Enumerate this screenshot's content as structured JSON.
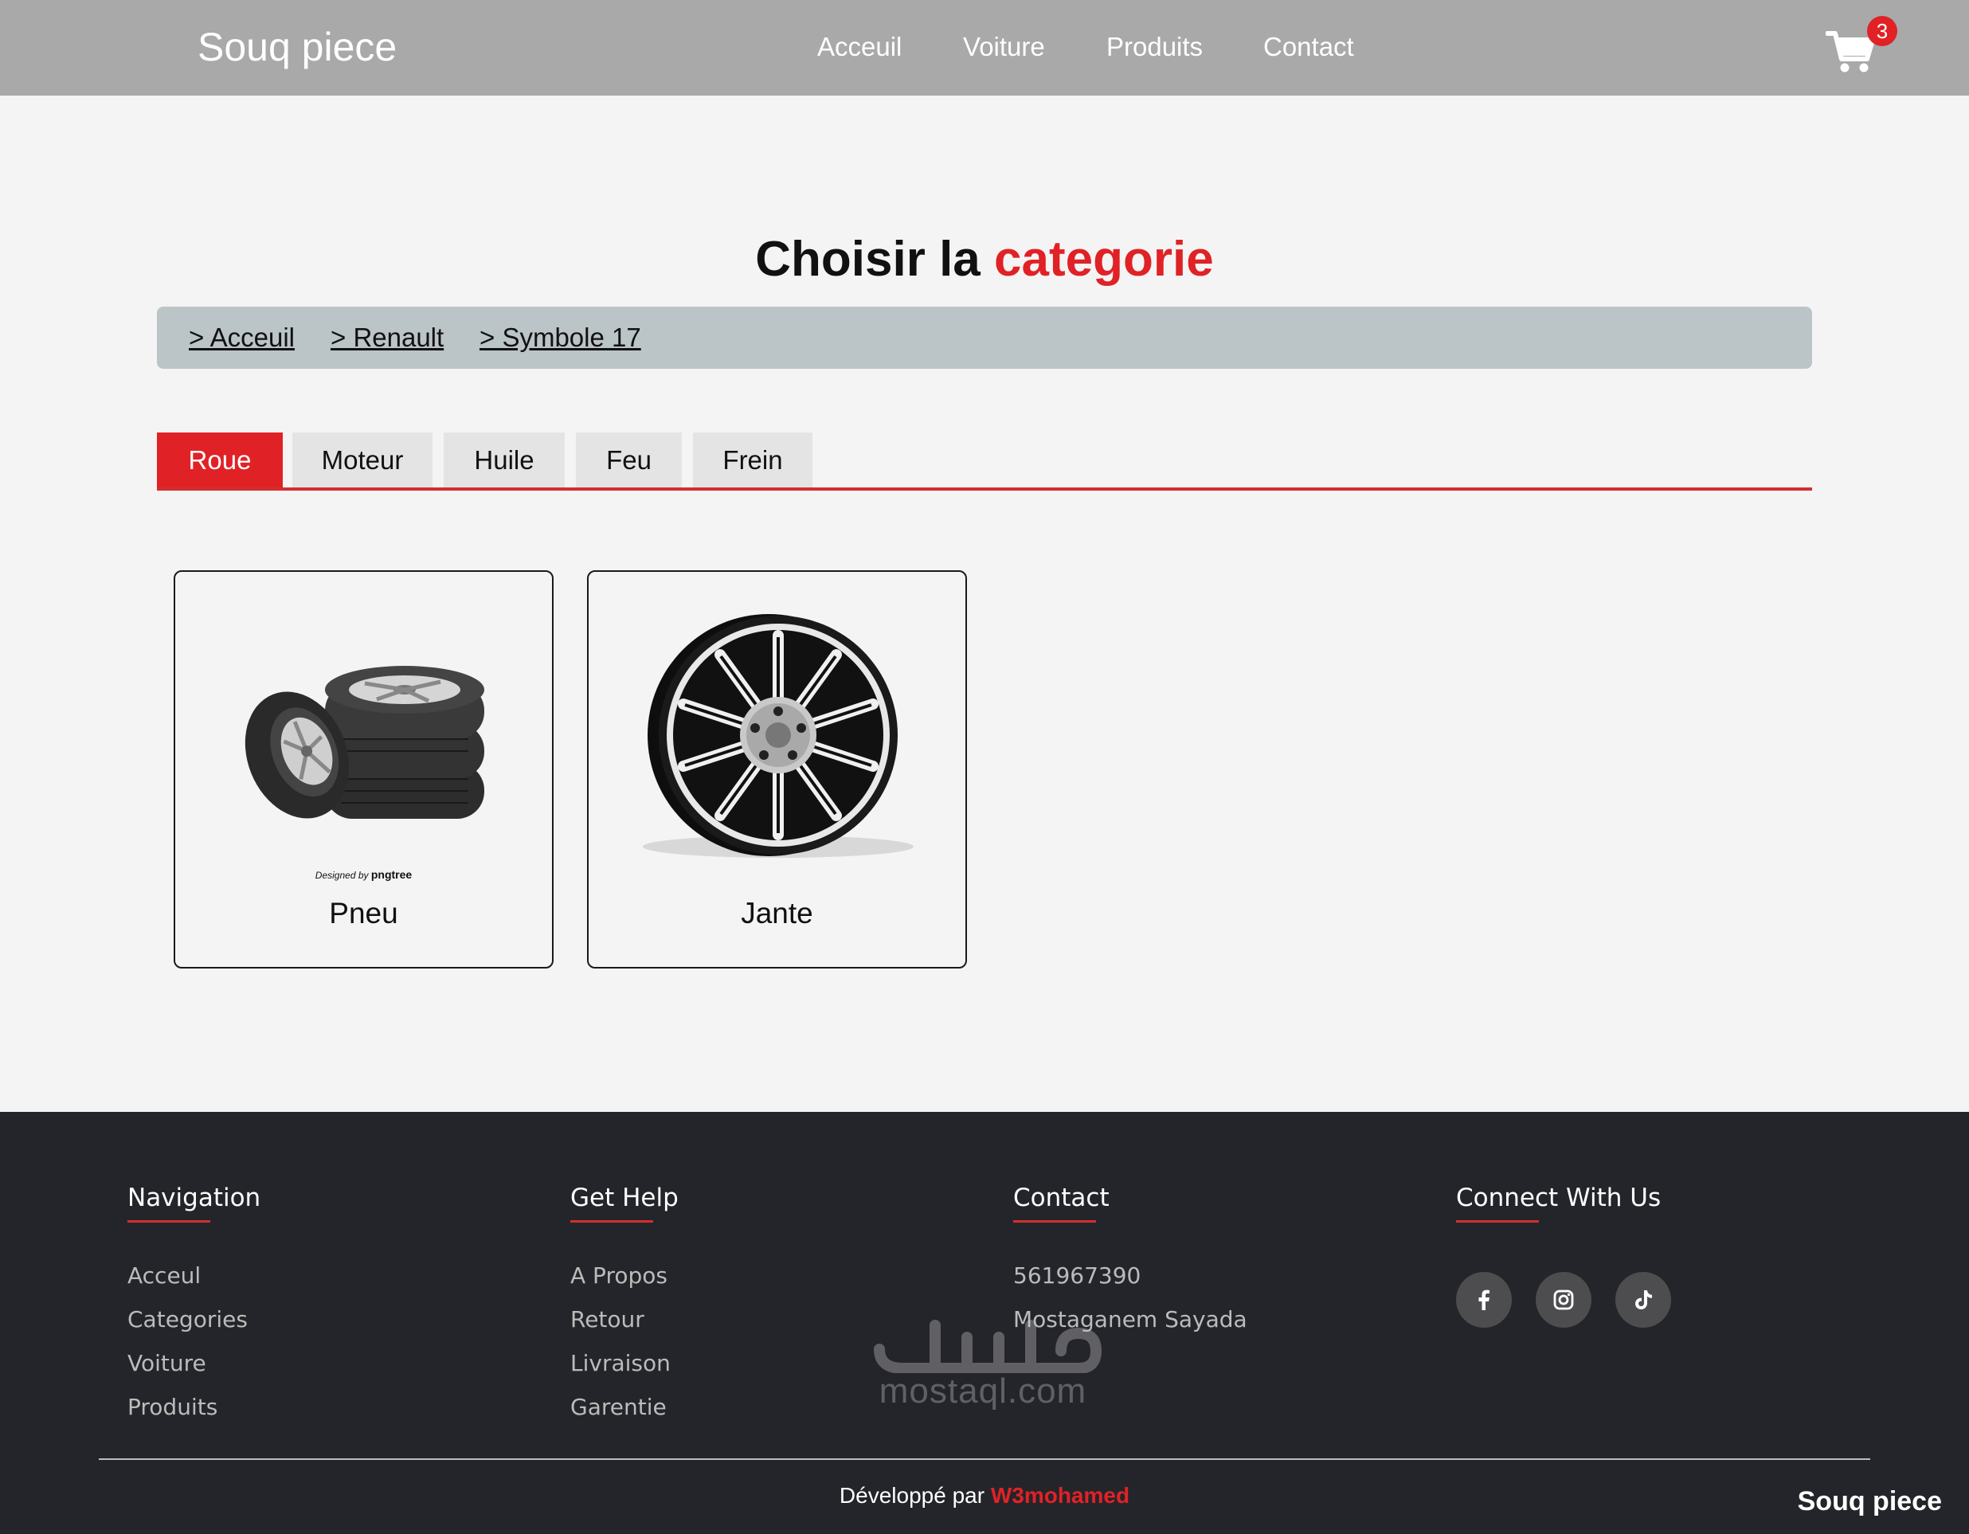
{
  "header": {
    "brand": "Souq piece",
    "nav": [
      "Acceuil",
      "Voiture",
      "Produits",
      "Contact"
    ],
    "cart_count": "3"
  },
  "page": {
    "title_main": "Choisir la",
    "title_accent": "categorie",
    "breadcrumb": [
      "> Acceuil",
      "> Renault ",
      "> Symbole 17"
    ],
    "tabs": [
      "Roue",
      "Moteur",
      "Huile",
      "Feu",
      "Frein"
    ],
    "active_tab": "Roue"
  },
  "cards": [
    {
      "label": "Pneu",
      "image": "tires-stack-image",
      "credit_prefix": "Designed by",
      "credit_brand": "pngtree"
    },
    {
      "label": "Jante",
      "image": "alloy-rim-image"
    }
  ],
  "footer": {
    "columns": [
      {
        "title": "Navigation",
        "links": [
          "Acceul",
          "Categories",
          "Voiture",
          "Produits"
        ]
      },
      {
        "title": "Get Help",
        "links": [
          "A Propos",
          "Retour",
          "Livraison",
          "Garentie"
        ]
      },
      {
        "title": "Contact",
        "links": [
          "561967390",
          "Mostaganem Sayada"
        ]
      },
      {
        "title": "Connect With Us",
        "socials": [
          "facebook-icon",
          "instagram-icon",
          "tiktok-icon"
        ]
      }
    ],
    "developer_prefix": "Développé par",
    "developer_name": "W3mohamed",
    "brand": "Souq piece",
    "watermark": "mostaql.com"
  },
  "colors": {
    "header_bg": "#a9a9a9",
    "accent": "#e02226",
    "breadcrumb_bg": "#bbc4c6",
    "footer_bg": "#24252a",
    "page_bg": "#f4f4f4"
  }
}
